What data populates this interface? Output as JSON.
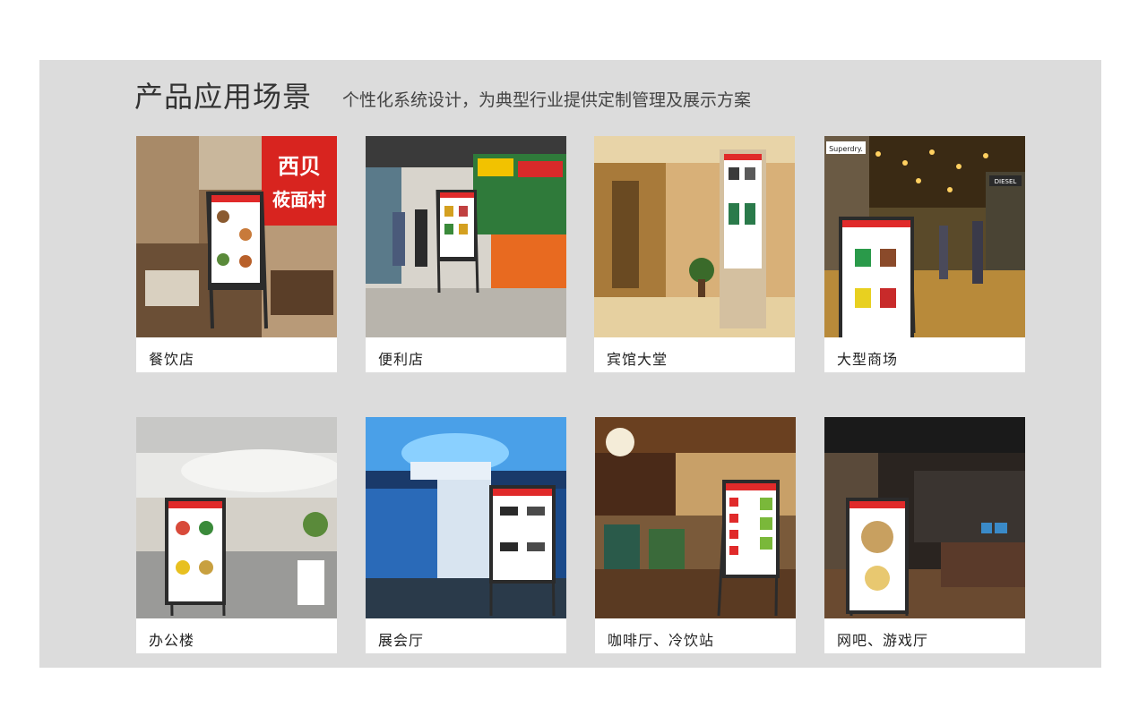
{
  "header": {
    "title": "产品应用场景",
    "subtitle": "个性化系统设计，为典型行业提供定制管理及展示方案"
  },
  "scenes": [
    {
      "label": "餐饮店",
      "sign_line1": "西贝",
      "sign_line2": "莜面村"
    },
    {
      "label": "便利店"
    },
    {
      "label": "宾馆大堂"
    },
    {
      "label": "大型商场",
      "store_sign": "Superdry.",
      "store_sign2": "DIESEL"
    },
    {
      "label": "办公楼"
    },
    {
      "label": "展会厅"
    },
    {
      "label": "咖啡厅、冷饮站"
    },
    {
      "label": "网吧、游戏厅"
    }
  ],
  "colors": {
    "panel": "#dcdcdc",
    "screen_red": "#e02a2a",
    "stand_dark": "#2b2b2b"
  }
}
